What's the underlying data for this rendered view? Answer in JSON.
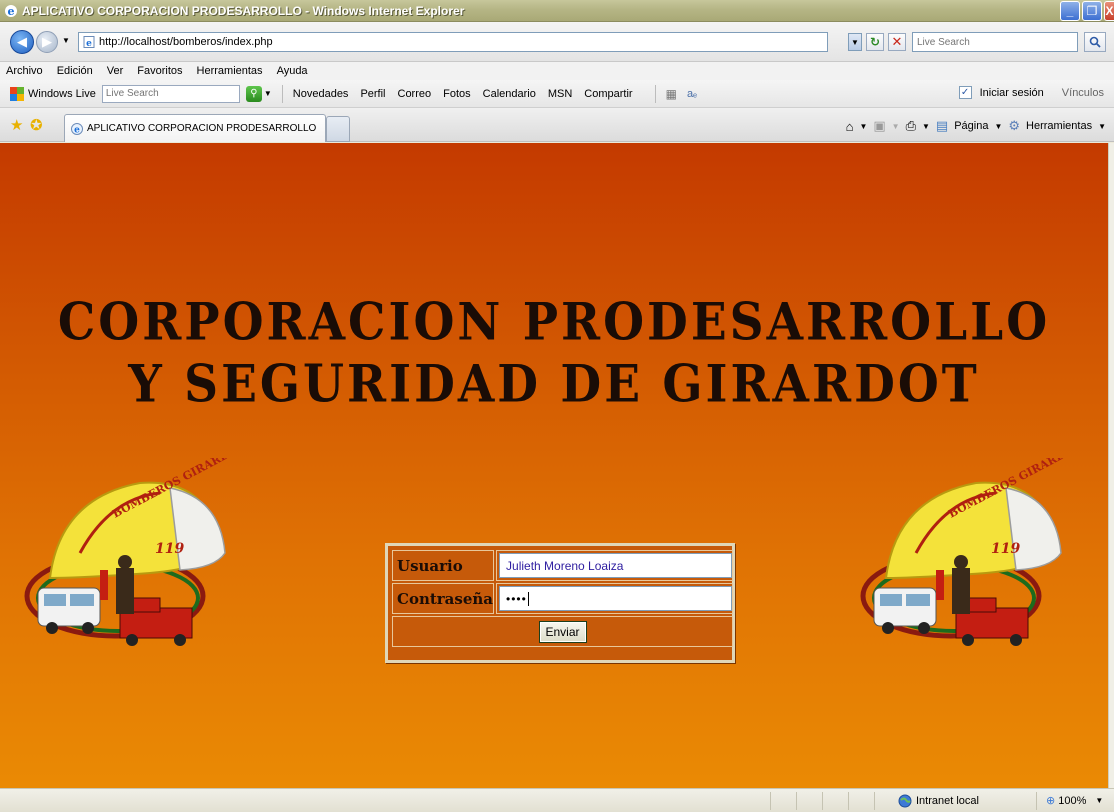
{
  "window": {
    "title": "APLICATIVO CORPORACION PRODESARROLLO - Windows Internet Explorer",
    "minimize": "_",
    "maximize": "❐",
    "close": "X"
  },
  "address_bar": {
    "url": "http://localhost/bomberos/index.php",
    "search_placeholder": "Live Search"
  },
  "menu": [
    "Archivo",
    "Edición",
    "Ver",
    "Favoritos",
    "Herramientas",
    "Ayuda"
  ],
  "live_toolbar": {
    "brand": "Windows Live",
    "search_placeholder": "Live Search",
    "links": [
      "Novedades",
      "Perfil",
      "Correo",
      "Fotos",
      "Calendario",
      "MSN",
      "Compartir"
    ],
    "signin": "Iniciar sesión",
    "vinculos": "Vínculos"
  },
  "tabs": {
    "active_title": "APLICATIVO CORPORACION PRODESARROLLO"
  },
  "command_bar": {
    "page": "Página",
    "tools": "Herramientas"
  },
  "page": {
    "heading_line1": "CORPORACION PRODESARROLLO",
    "heading_line2": "Y SEGURIDAD DE GIRARDOT",
    "logo_text": "BOMBEROS GIRARDOT",
    "logo_number": "119",
    "login": {
      "user_label": "Usuario",
      "user_value": "Julieth Moreno Loaiza",
      "password_label": "Contraseña",
      "password_value": "••••",
      "submit_label": "Enviar"
    }
  },
  "status_bar": {
    "zone": "Intranet local",
    "zoom": "100%"
  },
  "colors": {
    "page_top": "#c43a00",
    "page_bottom": "#ea8a04",
    "heading": "#1a0c06",
    "input_text": "#2e1da0"
  }
}
